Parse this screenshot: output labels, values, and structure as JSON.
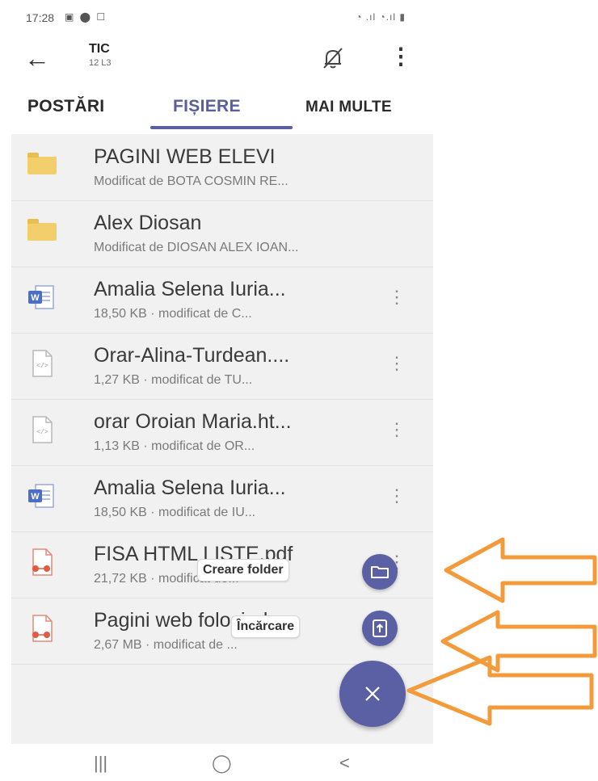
{
  "status_bar": {
    "time": "17:28",
    "left_icons": "▣ ⬤ ☐",
    "right_icons": "◔ .ıl ◔.ıl ▮"
  },
  "header": {
    "back_icon": "arrow-left",
    "title": "TIC",
    "subtitle": "12 L3",
    "mute_icon": "bell-off",
    "more_icon": "more-vertical"
  },
  "tabs": [
    {
      "label": "POSTĂRI",
      "selected": false
    },
    {
      "label": "FIȘIERE",
      "selected": true
    },
    {
      "label": "MAI MULTE",
      "selected": false
    }
  ],
  "files": [
    {
      "type": "folder",
      "name": "PAGINI WEB ELEVI",
      "meta": "Modificat de BOTA COSMIN RE...",
      "menu": ""
    },
    {
      "type": "folder",
      "name": "Alex Diosan",
      "meta": "Modificat de DIOSAN ALEX IOAN...",
      "menu": ""
    },
    {
      "type": "word",
      "name": "Amalia Selena Iuria...",
      "meta": "18,50 KB · modificat de C...",
      "menu": "⋮"
    },
    {
      "type": "html",
      "name": "Orar-Alina-Turdean....",
      "meta": "1,27 KB · modificat de TU...",
      "menu": "⋮"
    },
    {
      "type": "html",
      "name": "orar Oroian Maria.ht...",
      "meta": "1,13 KB · modificat de OR...",
      "menu": "⋮"
    },
    {
      "type": "word",
      "name": "Amalia Selena Iuria...",
      "meta": "18,50 KB · modificat de IU...",
      "menu": "⋮"
    },
    {
      "type": "pdf",
      "name": "FISA HTML LISTE.pdf",
      "meta": "21,72 KB · modificat de...",
      "menu": "⋮"
    },
    {
      "type": "pdf",
      "name": "Pagini web folosind...",
      "meta": "2,67 MB · modificat de ...",
      "menu": ""
    }
  ],
  "fab_menu": {
    "create_folder_label": "Creare folder",
    "upload_label": "Încărcare",
    "close_icon": "close"
  },
  "nav_bar": {
    "recents": "|||",
    "home": "◯",
    "back": "<"
  },
  "colors": {
    "accent": "#5b5fa4",
    "annotation_arrow": "#f39a3a",
    "folder": "#f2cf6a"
  }
}
